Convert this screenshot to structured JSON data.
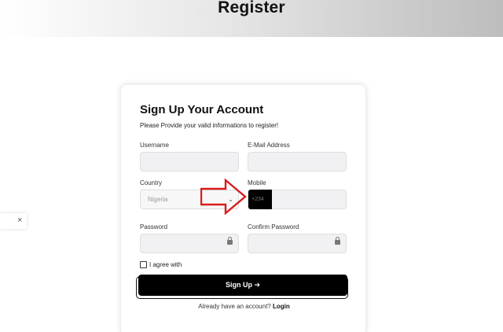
{
  "header": {
    "title": "Register"
  },
  "side_tab": {
    "close_label": "×"
  },
  "form": {
    "title": "Sign Up Your Account",
    "subtitle": "Please Provide your valid informations to register!",
    "username": {
      "label": "Username",
      "value": ""
    },
    "email": {
      "label": "E-Mail Address",
      "value": ""
    },
    "country": {
      "label": "Country",
      "selected": "Nigeria"
    },
    "mobile": {
      "label": "Mobile",
      "code": "+234",
      "value": ""
    },
    "password": {
      "label": "Password",
      "value": ""
    },
    "confirm_password": {
      "label": "Confirm Password",
      "value": ""
    },
    "agree_label": "I agree with",
    "submit_label": "Sign Up ➔",
    "login_prompt": "Already have an account?",
    "login_link": "Login"
  },
  "colors": {
    "annotation_arrow": "#d91c1c",
    "button_bg": "#000000",
    "field_bg": "#f1f1f3"
  }
}
